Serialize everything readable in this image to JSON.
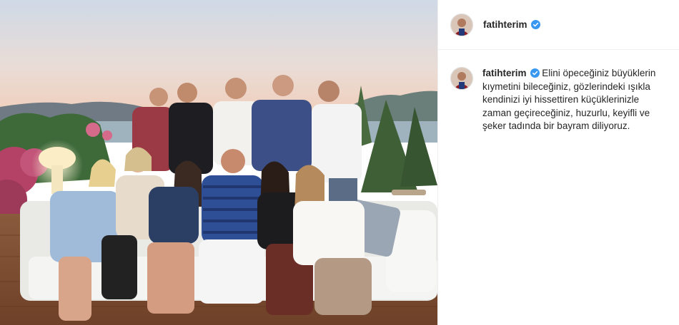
{
  "post": {
    "username": "fatihterim",
    "caption_text": "Elini öpeceğiniz büyüklerin kıymetini bileceğiniz, gözlerindeki ışıkla kendinizi iyi hissettiren küçüklerinizle zaman geçireceğiniz, huzurlu, keyifli ve şeker tadında bir bayram diliyoruz."
  },
  "icons": {
    "verified": "verified-badge-icon",
    "avatar": "profile-avatar"
  },
  "colors": {
    "verified": "#3897f0",
    "username": "#262626",
    "divider": "#efefef"
  }
}
